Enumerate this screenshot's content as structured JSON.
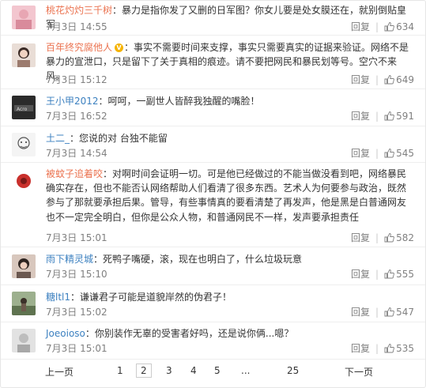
{
  "comments": [
    {
      "name": "桃花灼灼三千树",
      "verified": false,
      "text": "：暴力是指你发了又删的日军图？你女儿要是处女膜还在，就别倒贴皇军",
      "date": "7月3日 14:55",
      "reply": "回复",
      "likes": "634",
      "avatar_icon": "avatar-pink-image"
    },
    {
      "name": "百年终究腐他人",
      "verified": true,
      "text": "：事实不需要时间来支撑，事实只需要真实的证据来验证。网络不是暴力的宣泄口，只是留下了关于真相的痕迹。请不要把网民和暴民划等号。空穴不来风。",
      "date": "7月3日 15:12",
      "reply": "回复",
      "likes": "649",
      "avatar_icon": "avatar-girl-image"
    },
    {
      "name": "王小甲2012",
      "verified": false,
      "text": "：呵呵，一副世人皆醉我独醒的嘴脸！",
      "date": "7月3日 16:52",
      "reply": "回复",
      "likes": "591",
      "avatar_icon": "avatar-dark-image"
    },
    {
      "name": "土二_",
      "verified": false,
      "text": "：您说的对  台独不能留",
      "date": "7月3日 14:54",
      "reply": "回复",
      "likes": "545",
      "avatar_icon": "avatar-sketch-image"
    },
    {
      "name": "被蚊子追着咬",
      "verified": false,
      "text": "：对啊时间会证明一切。可是他已经做过的不能当做没看到吧，网络暴民确实存在，但也不能否认网络帮助人们看清了很多东西。艺术人为何要参与政治，既然参与了那就要承担后果。管导，有些事情真的要看清楚了再发声，他是黑是白普通网友也不一定完全明白，但你是公众人物，和普通网民不一样，发声要承担责任",
      "date": "7月3日 15:01",
      "reply": "回复",
      "likes": "582",
      "avatar_icon": "avatar-red-image"
    },
    {
      "name": "雨下精灵城",
      "verified": false,
      "text": "：死鸭子嘴硬，滚，现在也明白了，什么垃圾玩意",
      "date": "7月3日 15:10",
      "reply": "回复",
      "likes": "555",
      "avatar_icon": "avatar-girl2-image"
    },
    {
      "name": "糖ltl1",
      "verified": false,
      "text": "：谦谦君子可能是道貌岸然的伪君子！",
      "date": "7月3日 15:02",
      "reply": "回复",
      "likes": "547",
      "avatar_icon": "avatar-outdoor-image"
    },
    {
      "name": "Joeoioso",
      "verified": false,
      "text": "：你别装作无辜的受害者好吗，还是说你俩...嗯？",
      "date": "7月3日 15:01",
      "reply": "回复",
      "likes": "535",
      "avatar_icon": "avatar-gray-image"
    }
  ],
  "pager": {
    "prev": "上一页",
    "pages": [
      "1",
      "2",
      "3",
      "4",
      "5"
    ],
    "current": "2",
    "ellipsis": "...",
    "last": "25",
    "next": "下一页"
  },
  "colors": {
    "name": "#eb7350",
    "blue_name": "#3d81c0",
    "meta": "#808080",
    "verified_badge": "#f5b300"
  }
}
